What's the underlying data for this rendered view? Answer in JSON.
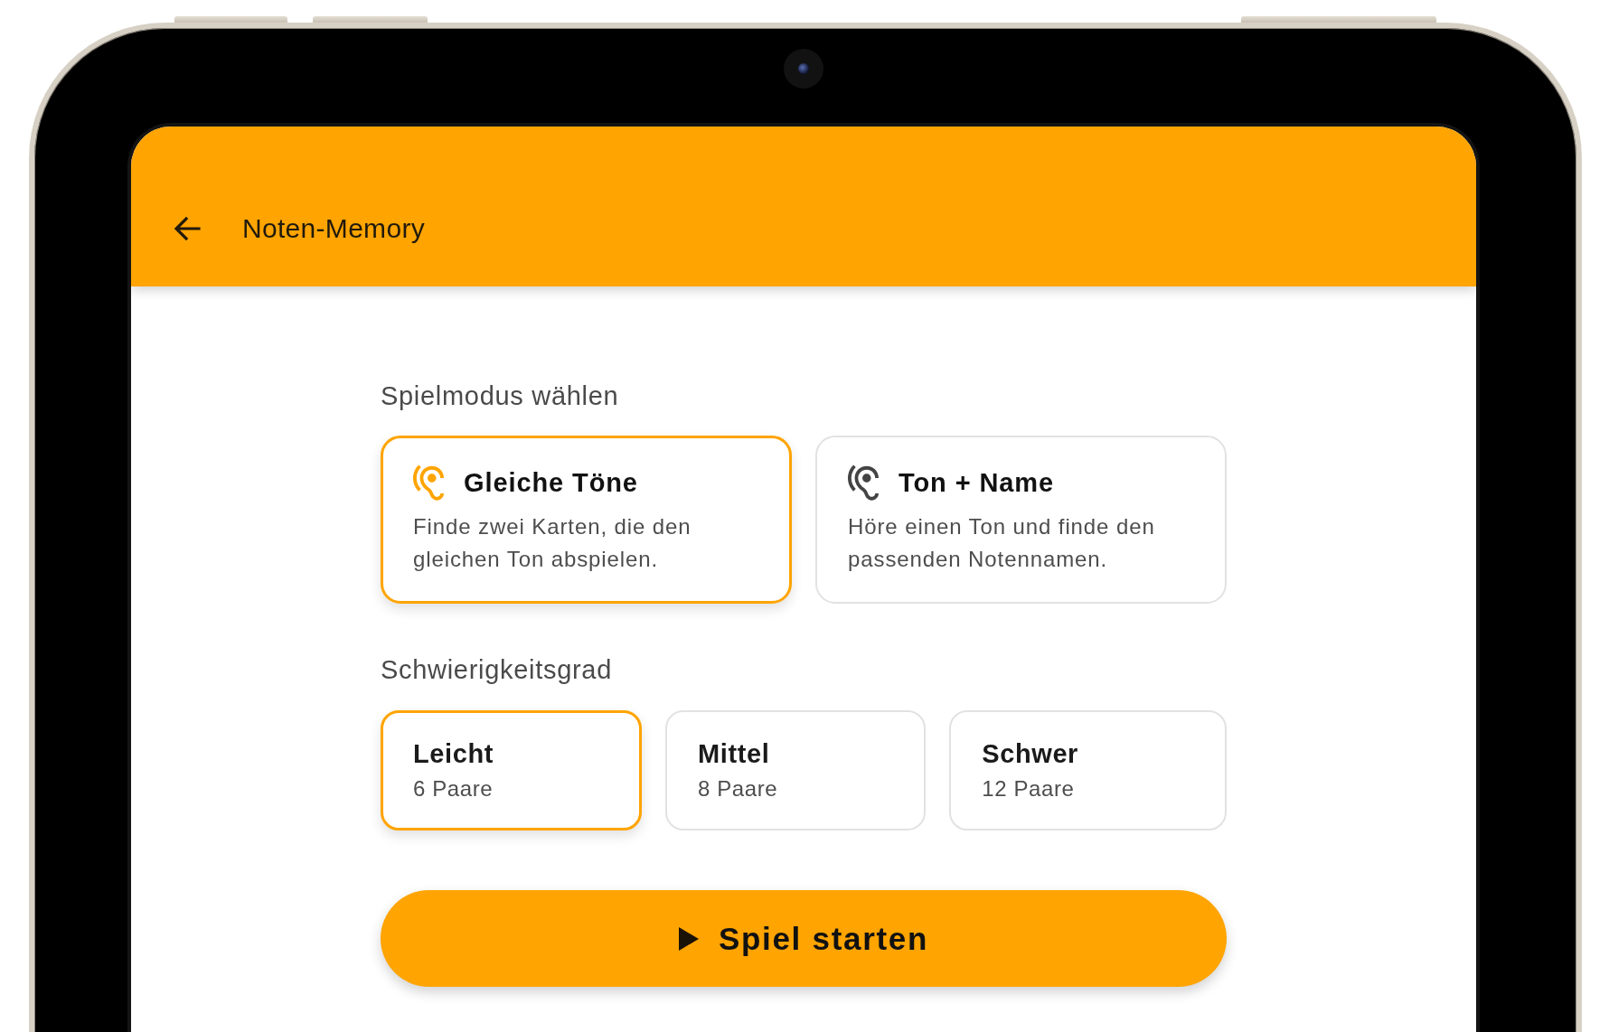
{
  "app_bar": {
    "title": "Noten-Memory"
  },
  "mode_section": {
    "heading": "Spielmodus wählen",
    "modes": [
      {
        "title": "Gleiche Töne",
        "description": "Finde zwei Karten, die den gleichen Ton abspielen.",
        "selected": true
      },
      {
        "title": "Ton + Name",
        "description": "Höre einen Ton und finde den passenden Notennamen.",
        "selected": false
      }
    ]
  },
  "difficulty_section": {
    "heading": "Schwierigkeitsgrad",
    "levels": [
      {
        "name": "Leicht",
        "detail": "6 Paare",
        "selected": true
      },
      {
        "name": "Mittel",
        "detail": "8 Paare",
        "selected": false
      },
      {
        "name": "Schwer",
        "detail": "12 Paare",
        "selected": false
      }
    ]
  },
  "start_button": {
    "label": "Spiel starten"
  }
}
